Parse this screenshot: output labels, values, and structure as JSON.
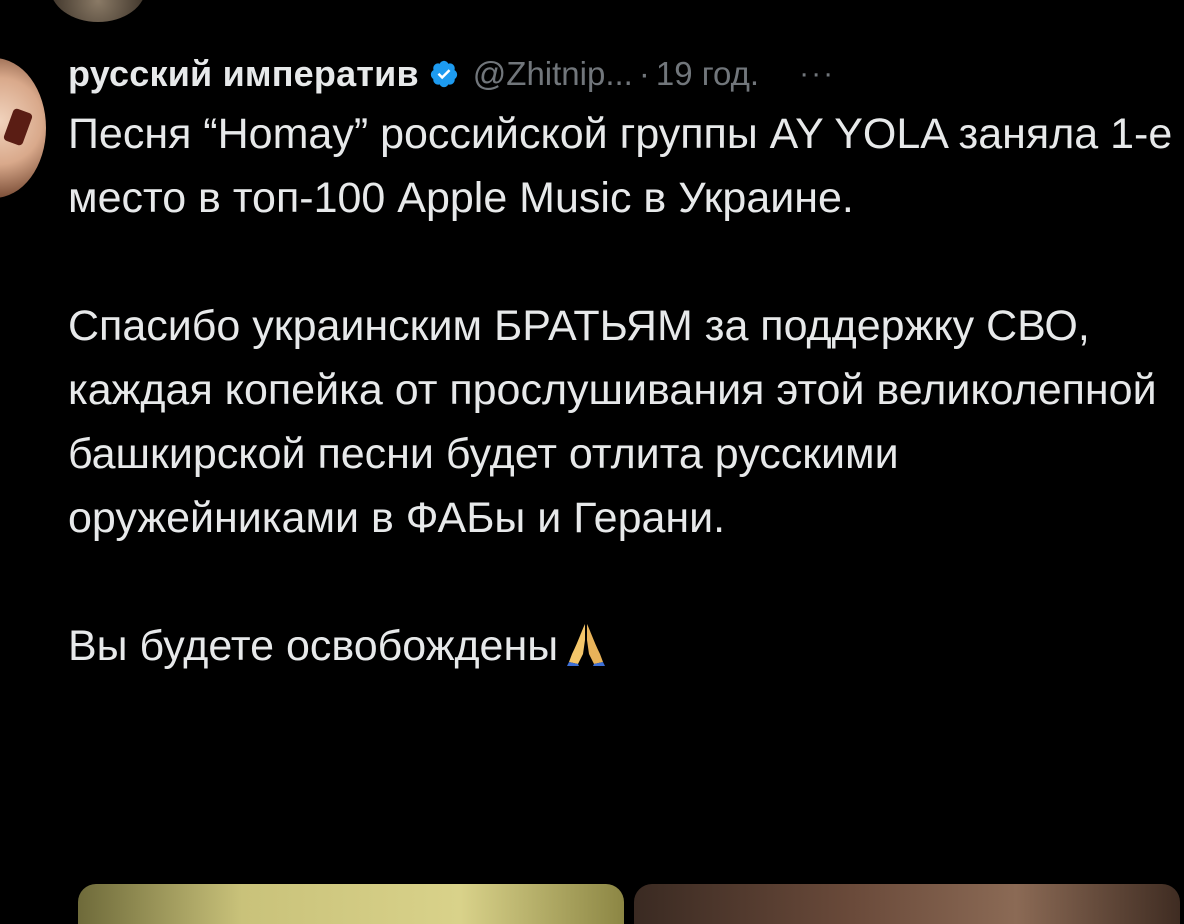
{
  "tweet": {
    "author_name": "русский императив",
    "author_handle": "@Zhitnip...",
    "dot": "·",
    "time": "19 год.",
    "more": "···",
    "paragraphs": [
      "Песня “Homay” российской группы AY YOLA заняла 1-е место в топ-100 Apple Music в Украине.",
      "Спасибо украинским БРАТЬЯМ за поддержку СВО, каждая копейка от прослушивания этой великолепной башкирской песни будет отлита русскими оружейниками в ФАБы и Герани.",
      "Вы будете освобождены"
    ]
  },
  "icons": {
    "verified": "verified-badge-icon",
    "more": "more-icon",
    "emoji": "pray-icon"
  },
  "colors": {
    "background": "#000000",
    "text": "#e7e9ea",
    "muted": "#71767b",
    "verified": "#1d9bf0"
  }
}
